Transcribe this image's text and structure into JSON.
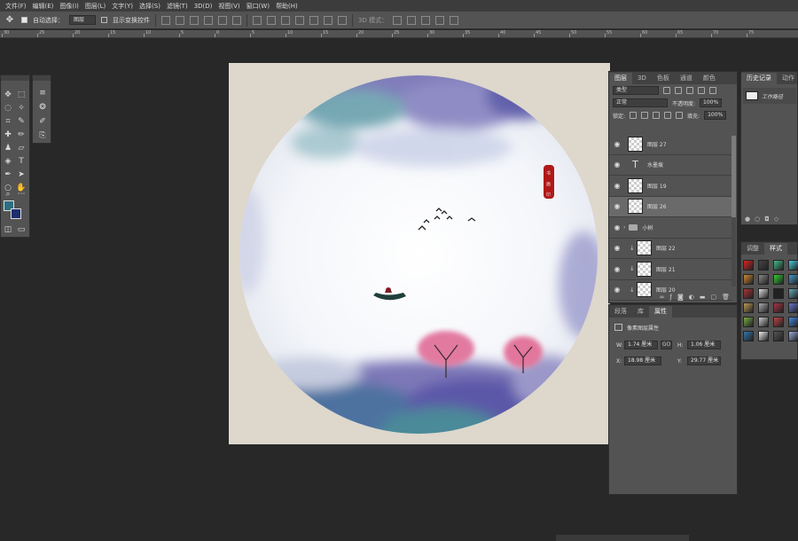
{
  "menu": [
    "文件(F)",
    "编辑(E)",
    "图像(I)",
    "图层(L)",
    "文字(Y)",
    "选择(S)",
    "滤镜(T)",
    "3D(D)",
    "视图(V)",
    "窗口(W)",
    "帮助(H)"
  ],
  "options": {
    "auto_select_label": "自动选择：",
    "auto_select_value": "图层",
    "show_transform_label": "显示变换控件",
    "mode_3d_label": "3D 模式："
  },
  "ruler_ticks": [
    "30",
    "25",
    "20",
    "15",
    "10",
    "5",
    "0",
    "5",
    "10",
    "15",
    "20",
    "25",
    "30",
    "35",
    "40",
    "45",
    "50",
    "55",
    "60",
    "65",
    "70",
    "75"
  ],
  "layers_panel": {
    "tabs": [
      "图层",
      "3D",
      "色板",
      "通道",
      "颜色"
    ],
    "filter_kind": "类型",
    "blend_mode": "正常",
    "opacity_label": "不透明度:",
    "opacity_value": "100%",
    "lock_label": "锁定:",
    "fill_label": "填充:",
    "fill_value": "100%",
    "layers": [
      {
        "name": "图层 27",
        "kind": "pixel",
        "selected": false,
        "indent": false
      },
      {
        "name": "水墨痕",
        "kind": "text",
        "selected": false,
        "indent": false
      },
      {
        "name": "图层 19",
        "kind": "pixel",
        "selected": false,
        "indent": false
      },
      {
        "name": "图层 26",
        "kind": "pixel",
        "selected": true,
        "indent": false
      },
      {
        "name": "小树",
        "kind": "group",
        "selected": false,
        "indent": false
      },
      {
        "name": "图层 22",
        "kind": "pixel",
        "selected": false,
        "indent": true
      },
      {
        "name": "图层 21",
        "kind": "pixel",
        "selected": false,
        "indent": true
      },
      {
        "name": "图层 20",
        "kind": "pixel",
        "selected": false,
        "indent": true
      }
    ]
  },
  "props_panel": {
    "tabs": [
      "段落",
      "库",
      "属性"
    ],
    "title": "像素图层属性",
    "w_label": "W:",
    "w_value": "1.74 厘米",
    "h_label": "H:",
    "h_value": "1.06 厘米",
    "x_label": "X:",
    "x_value": "18.98 厘米",
    "y_label": "Y:",
    "y_value": "29.77 厘米",
    "link_label": "GO"
  },
  "history_panel": {
    "tabs": [
      "历史记录",
      "动作"
    ],
    "item": "工作路径"
  },
  "styles_panel": {
    "tabs": [
      "调整",
      "样式"
    ],
    "swatch_colors": [
      "#d22",
      "#444",
      "#4b8",
      "#4cd",
      "#c83",
      "#888",
      "#3c3",
      "#49c",
      "#a33",
      "#ddd",
      "#222",
      "#6ab",
      "#b95",
      "#aaa",
      "#a34",
      "#67c",
      "#7a4",
      "#ccc",
      "#b44",
      "#48d",
      "#37a",
      "#eee",
      "#555",
      "#9ad"
    ]
  },
  "colors": {
    "foreground": "#2d6f82",
    "background": "#1e2e6e",
    "seal": "#b01818"
  }
}
